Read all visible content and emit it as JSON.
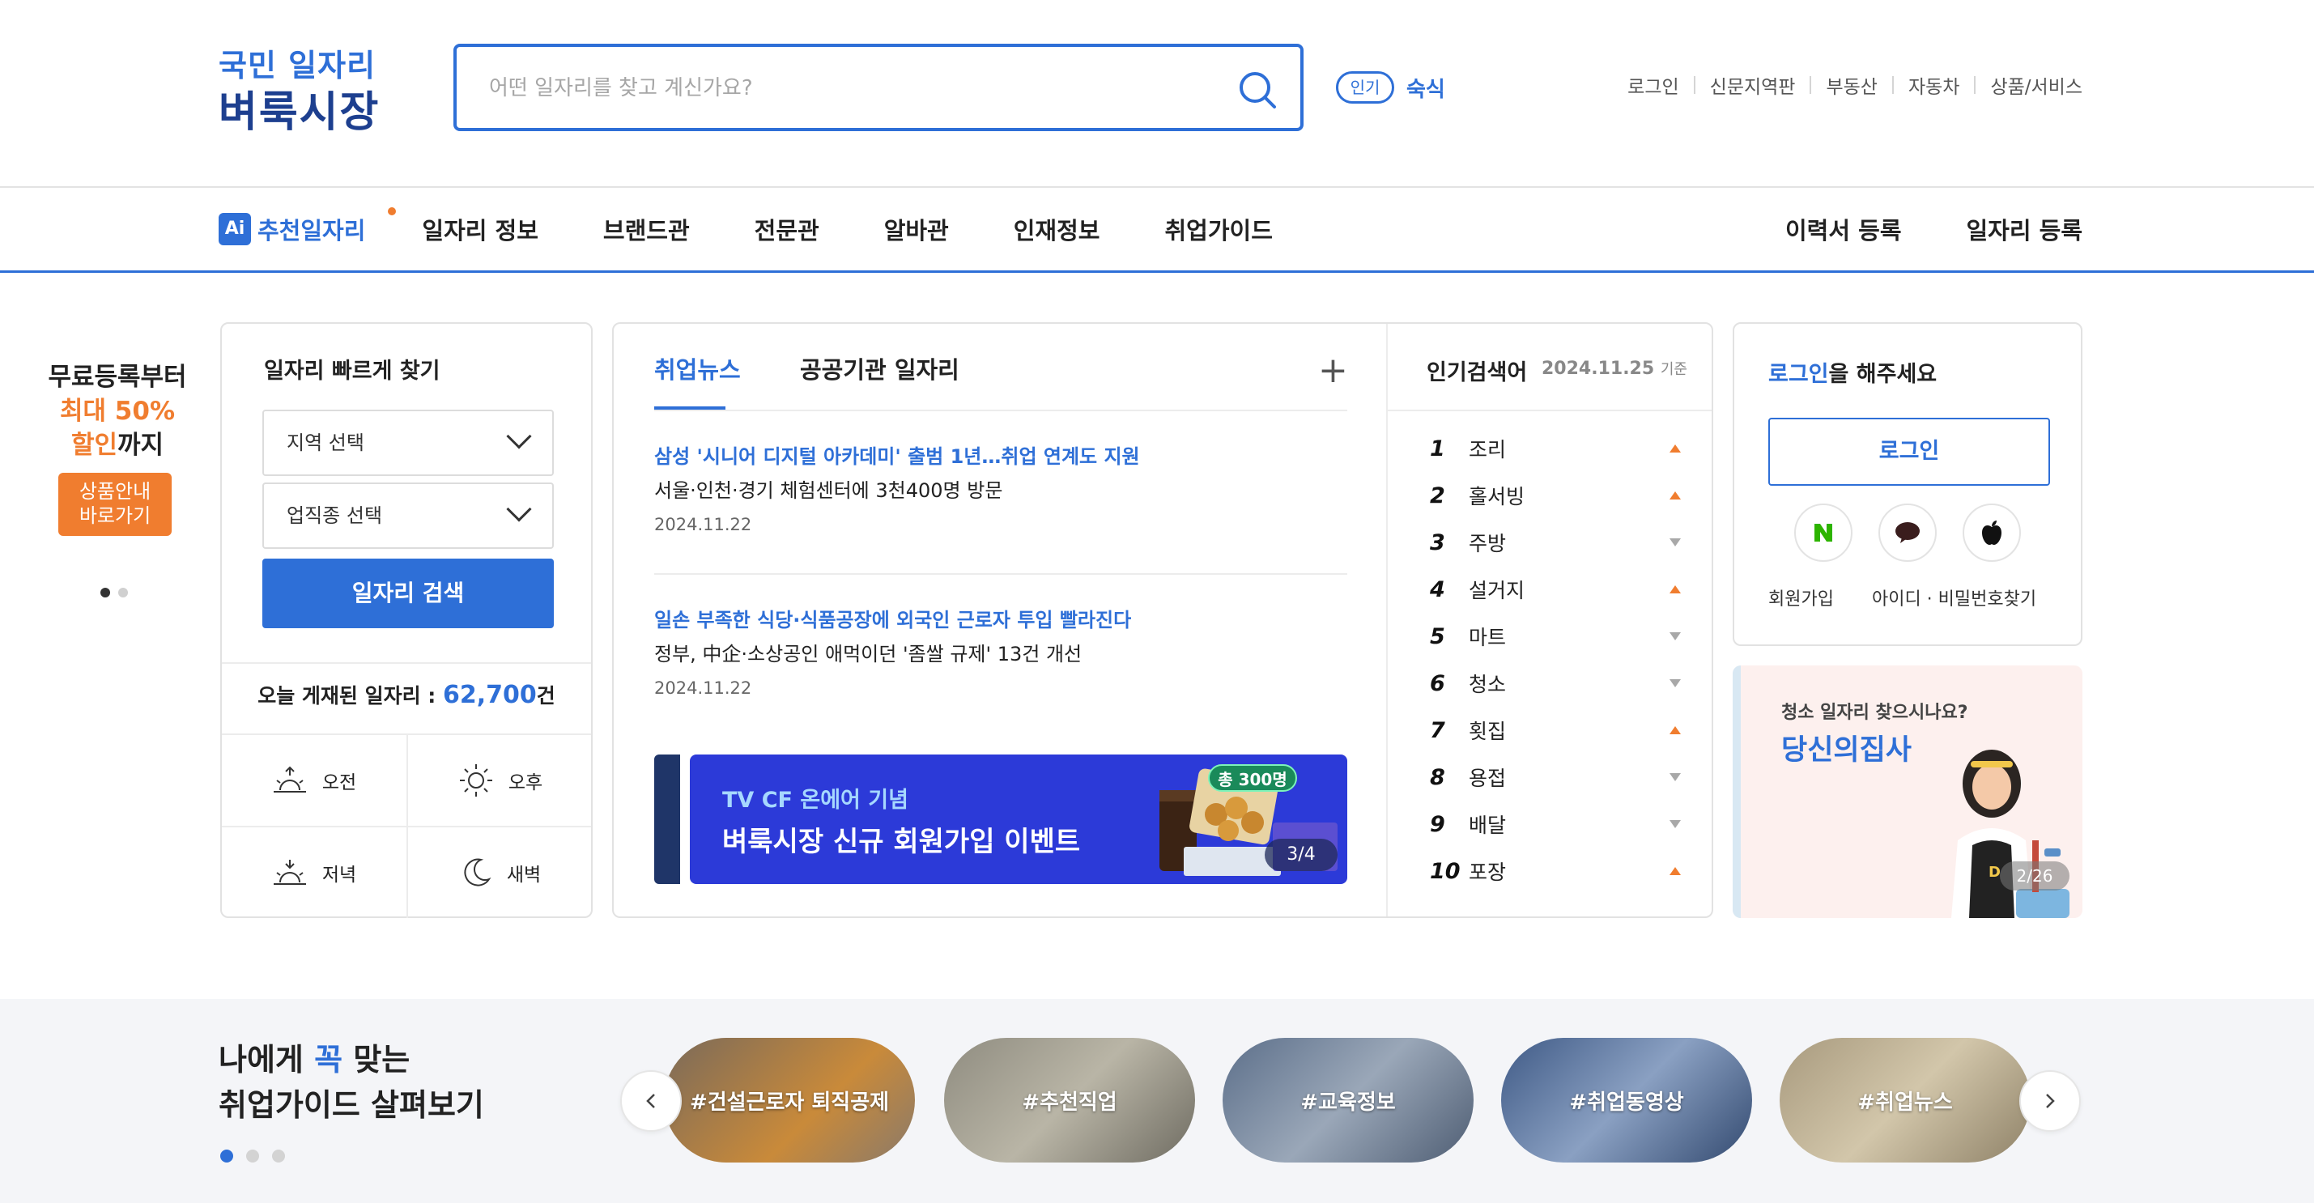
{
  "brand": {
    "line1": "국민 일자리",
    "line2": "벼룩시장"
  },
  "search": {
    "placeholder": "어떤 일자리를 찾고 계신가요?",
    "value": "",
    "popular_badge": "인기",
    "popular_word": "숙식"
  },
  "util_links": [
    "로그인",
    "신문지역판",
    "부동산",
    "자동차",
    "상품/서비스"
  ],
  "nav": {
    "ai_badge": "Ai",
    "ai_label": "추천일자리",
    "items": [
      "일자리 정보",
      "브랜드관",
      "전문관",
      "알바관",
      "인재정보",
      "취업가이드"
    ],
    "right": [
      "이력서 등록",
      "일자리 등록"
    ]
  },
  "promo": {
    "line1": "무료등록부터",
    "line2": "최대 50%",
    "line3_hl": "할인",
    "line3_rest": "까지",
    "button": "상품안내\n바로가기"
  },
  "quick_search": {
    "title": "일자리 빠르게 찾기",
    "region": "지역 선택",
    "job_type": "업직종 선택",
    "search_button": "일자리 검색",
    "today_label": "오늘 게재된 일자리 : ",
    "today_count": "62,700",
    "today_unit": "건",
    "times": [
      "오전",
      "오후",
      "저녁",
      "새벽"
    ]
  },
  "news": {
    "tabs": [
      "취업뉴스",
      "공공기관 일자리"
    ],
    "items": [
      {
        "title": "삼성 '시니어 디지털 아카데미' 출범 1년…취업 연계도 지원",
        "sub": "서울·인천·경기 체험센터에 3천400명 방문",
        "date": "2024.11.22"
      },
      {
        "title": "일손 부족한 식당·식품공장에 외국인 근로자 투입 빨라진다",
        "sub": "정부, 中企·소상공인 애먹이던 '좀쌀 규제' 13건 개선",
        "date": "2024.11.22"
      }
    ],
    "banner": {
      "line1": "TV CF 온에어 기념",
      "line2": "벼룩시장 신규 회원가입 이벤트",
      "tag": "총 300명",
      "page": "3/4"
    }
  },
  "popular": {
    "title": "인기검색어",
    "date": "2024.11.25",
    "date_suffix": "기준",
    "ranks": [
      {
        "num": "1",
        "word": "조리",
        "trend": "up"
      },
      {
        "num": "2",
        "word": "홀서빙",
        "trend": "up"
      },
      {
        "num": "3",
        "word": "주방",
        "trend": "down"
      },
      {
        "num": "4",
        "word": "설거지",
        "trend": "up"
      },
      {
        "num": "5",
        "word": "마트",
        "trend": "down"
      },
      {
        "num": "6",
        "word": "청소",
        "trend": "down"
      },
      {
        "num": "7",
        "word": "횟집",
        "trend": "up"
      },
      {
        "num": "8",
        "word": "용접",
        "trend": "down"
      },
      {
        "num": "9",
        "word": "배달",
        "trend": "down"
      },
      {
        "num": "10",
        "word": "포장",
        "trend": "up"
      }
    ]
  },
  "login": {
    "msg_hl": "로그인",
    "msg_rest": "을 해주세요",
    "button": "로그인",
    "join": "회원가입",
    "find": "아이디 · 비밀번호찾기",
    "sns": [
      "naver-icon",
      "kakao-icon",
      "apple-icon"
    ]
  },
  "ad": {
    "line1": "청소 일자리 찾으시나요?",
    "line2": "당신의집사",
    "page": "2/26"
  },
  "guide": {
    "title_pre": "나에게 ",
    "title_hl": "꼭",
    "title_post": " 맞는",
    "title_line2": "취업가이드 살펴보기",
    "pills": [
      "#건설근로자 퇴직공제",
      "#추천직업",
      "#교육정보",
      "#취업동영상",
      "#취업뉴스"
    ]
  },
  "colors": {
    "accent": "#2e6fd7",
    "orange": "#f07d2f"
  }
}
